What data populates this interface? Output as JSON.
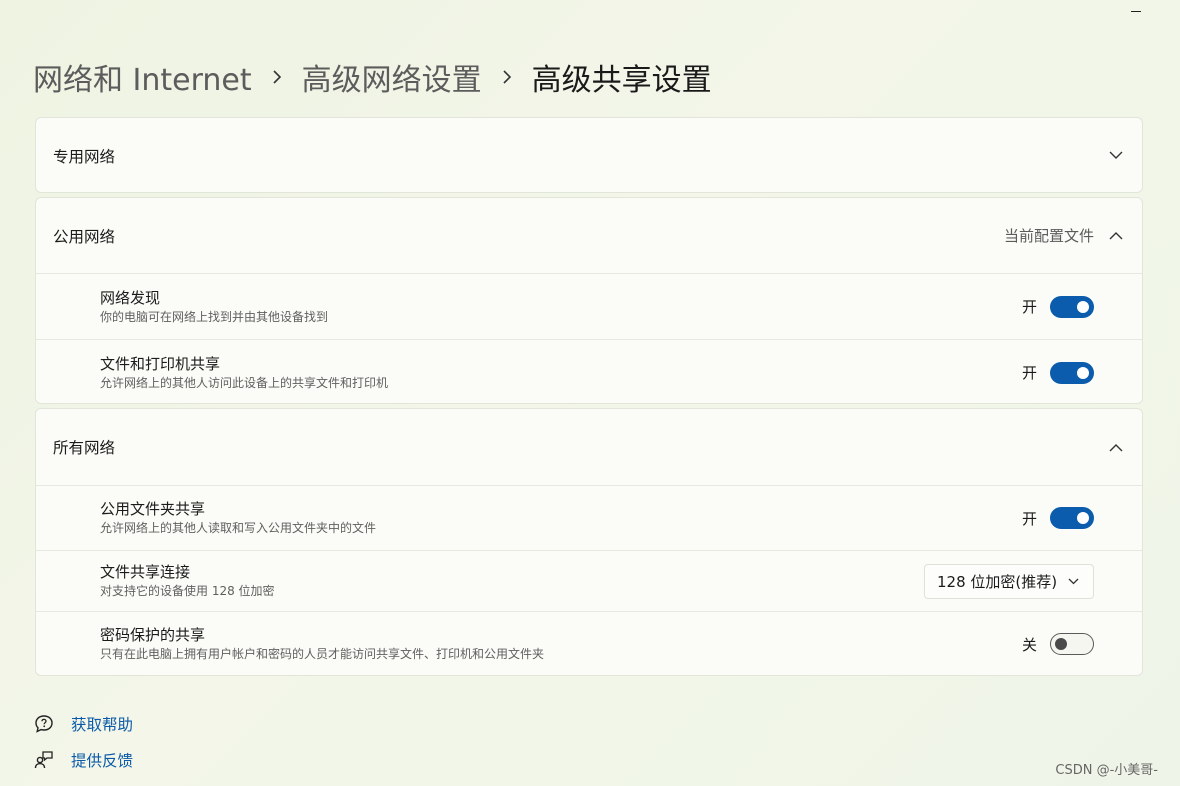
{
  "window": {
    "minimize_label": "–"
  },
  "breadcrumb": {
    "items": [
      {
        "label": "网络和 Internet"
      },
      {
        "label": "高级网络设置"
      },
      {
        "label": "高级共享设置"
      }
    ]
  },
  "sections": [
    {
      "title": "专用网络",
      "expanded": false
    },
    {
      "title": "公用网络",
      "right_text": "当前配置文件",
      "expanded": true,
      "rows": [
        {
          "label": "网络发现",
          "desc": "你的电脑可在网络上找到并由其他设备找到",
          "state": "开",
          "on": true
        },
        {
          "label": "文件和打印机共享",
          "desc": "允许网络上的其他人访问此设备上的共享文件和打印机",
          "state": "开",
          "on": true
        }
      ]
    },
    {
      "title": "所有网络",
      "expanded": true,
      "rows": [
        {
          "label": "公用文件夹共享",
          "desc": "允许网络上的其他人读取和写入公用文件夹中的文件",
          "state": "开",
          "on": true
        },
        {
          "label": "文件共享连接",
          "desc": "对支持它的设备使用 128 位加密",
          "select_value": "128 位加密(推荐)"
        },
        {
          "label": "密码保护的共享",
          "desc": "只有在此电脑上拥有用户帐户和密码的人员才能访问共享文件、打印机和公用文件夹",
          "state": "关",
          "on": false
        }
      ]
    }
  ],
  "footer": {
    "help_label": "获取帮助",
    "feedback_label": "提供反馈"
  },
  "watermark": "CSDN @-小美哥-",
  "colors": {
    "accent": "#0b5cad",
    "link": "#0a5aa8"
  },
  "icons": {
    "minimize": "minimize-icon",
    "breadcrumb_separator": "chevron-right-icon",
    "collapsed": "chevron-down-icon",
    "expanded": "chevron-up-icon",
    "help": "help-chat-icon",
    "feedback": "feedback-person-icon"
  }
}
